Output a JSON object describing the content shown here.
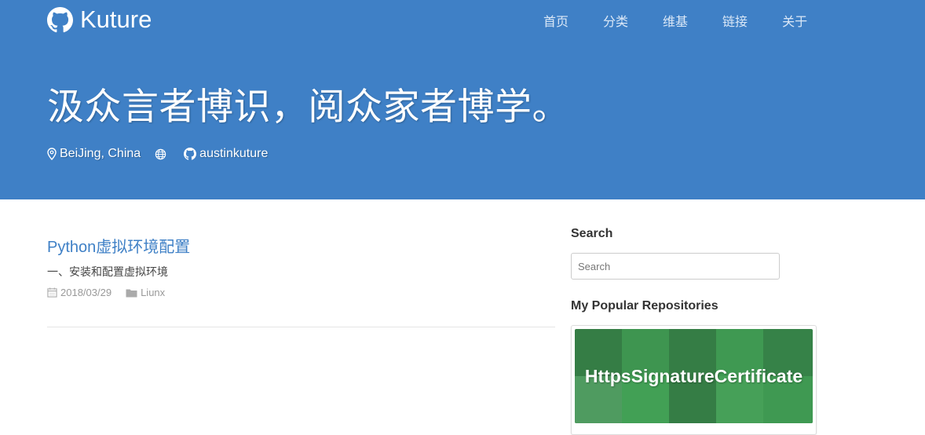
{
  "brand": {
    "name": "Kuture",
    "icon": "github-icon"
  },
  "nav": {
    "items": [
      "首页",
      "分类",
      "维基",
      "链接",
      "关于"
    ]
  },
  "hero": {
    "headline": "汲众言者博识，阅众家者博学。",
    "location": "BeiJing, China",
    "location_icon": "map-marker-icon",
    "extra_icon": "globe-icon",
    "github_user": "austinkuture",
    "github_icon": "github-icon"
  },
  "post": {
    "title": "Python虚拟环境配置",
    "excerpt": "一、安装和配置虚拟环境",
    "date": "2018/03/29",
    "date_icon": "calendar-icon",
    "category": "Liunx",
    "category_icon": "folder-icon"
  },
  "sidebar": {
    "search_heading": "Search",
    "search_placeholder": "Search",
    "repos_heading": "My Popular Repositories",
    "repos": [
      {
        "name": "HttpsSignatureCertificate"
      }
    ]
  },
  "colors": {
    "header_bg": "#3f80c6",
    "link": "#3f80c6",
    "repo_green": "#3e9550"
  }
}
